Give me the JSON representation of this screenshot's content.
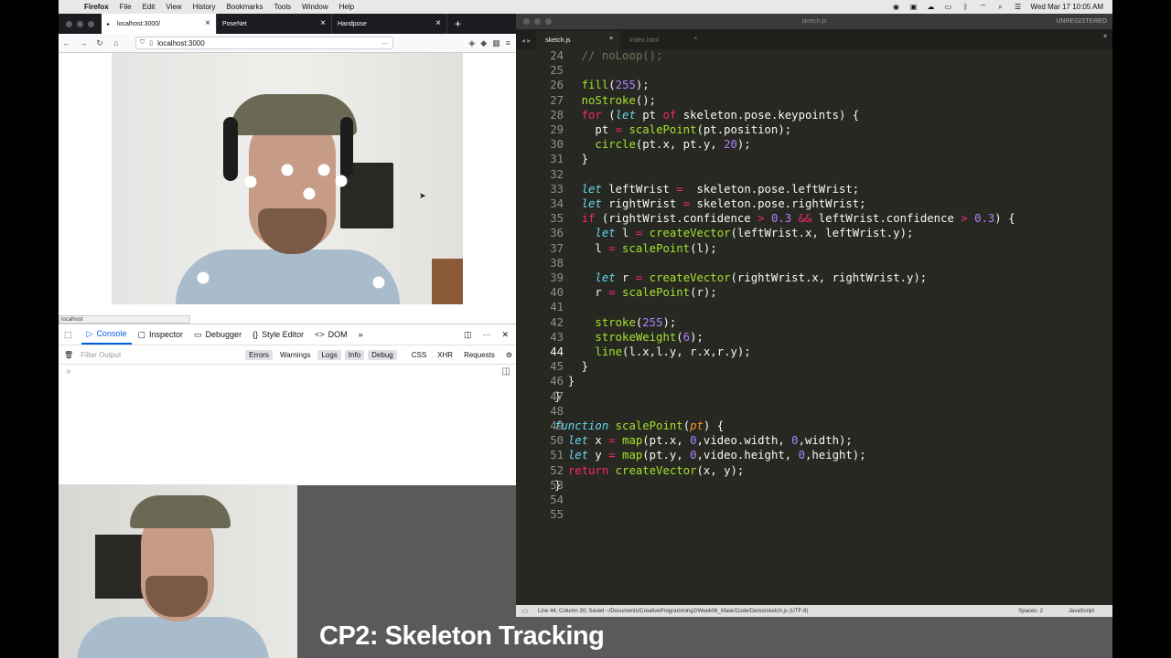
{
  "menubar": {
    "app": "Firefox",
    "items": [
      "File",
      "Edit",
      "View",
      "History",
      "Bookmarks",
      "Tools",
      "Window",
      "Help"
    ],
    "clock": "Wed Mar 17  10:05 AM"
  },
  "firefox": {
    "tabs": [
      {
        "label": "localhost:3000/"
      },
      {
        "label": "PoseNet"
      },
      {
        "label": "Handpose"
      }
    ],
    "url": "localhost:3000",
    "status_text": "localhost",
    "devtools": {
      "tabs": [
        "Console",
        "Inspector",
        "Debugger",
        "Style Editor",
        "DOM"
      ],
      "filter_placeholder": "Filter Output",
      "filters": [
        "Errors",
        "Warnings",
        "Logs",
        "Info",
        "Debug",
        "CSS",
        "XHR",
        "Requests"
      ],
      "prompt": "»"
    }
  },
  "sublime": {
    "title": "sketch.js",
    "unregistered": "UNREGISTERED",
    "tabs": [
      "sketch.js",
      "index.html"
    ],
    "status_left": "Line 44, Column 30; Saved ~/Documents/CreativeProgramming2/Week06_Mask/Code/Demo/sketch.js (UTF-8)",
    "status_spaces": "Spaces: 2",
    "status_lang": "JavaScript",
    "lines": [
      24,
      25,
      26,
      27,
      28,
      29,
      30,
      31,
      32,
      33,
      34,
      35,
      36,
      37,
      38,
      39,
      40,
      41,
      42,
      43,
      44,
      45,
      46,
      47,
      48,
      49,
      50,
      51,
      52,
      53,
      54,
      55
    ]
  },
  "caption": "CP2: Skeleton Tracking"
}
